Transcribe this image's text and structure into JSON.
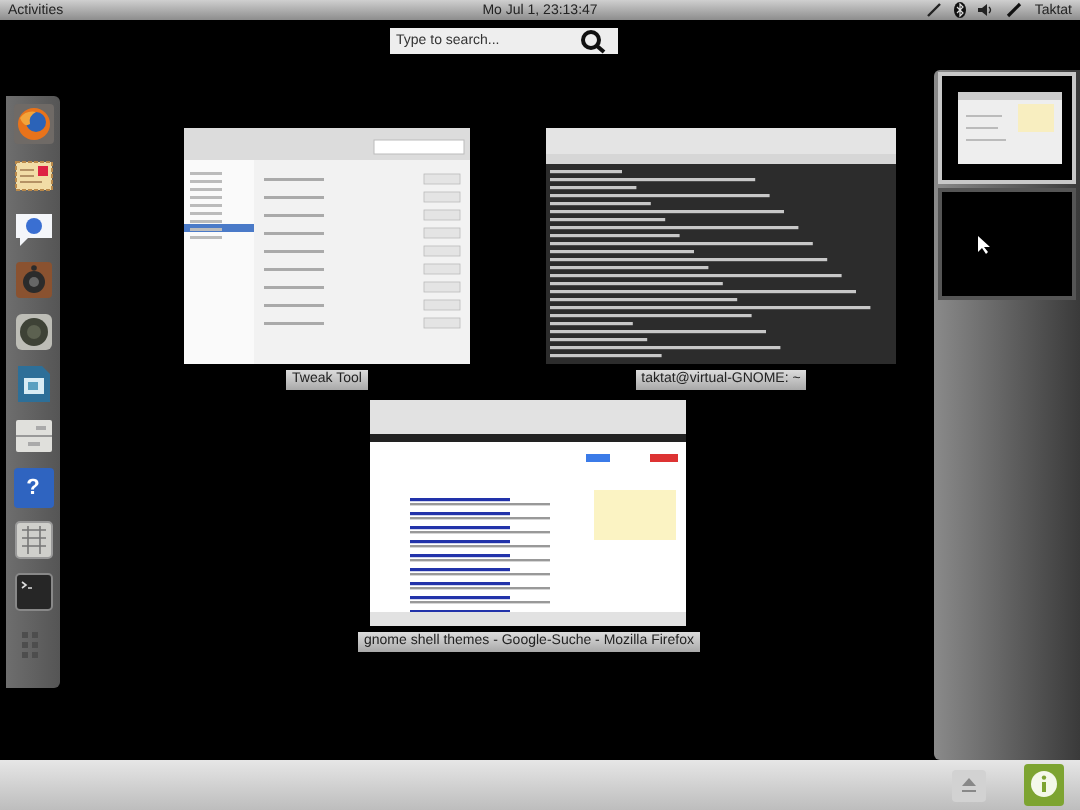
{
  "top_bar": {
    "activities": "Activities",
    "clock": "Mo Jul 1, 23:13:47",
    "user": "Taktat"
  },
  "search": {
    "placeholder": "Type to search..."
  },
  "dash": {
    "items": [
      {
        "kind": "browser"
      },
      {
        "kind": "mail"
      },
      {
        "kind": "chat"
      },
      {
        "kind": "speaker"
      },
      {
        "kind": "webcam"
      },
      {
        "kind": "document"
      },
      {
        "kind": "drawer"
      },
      {
        "kind": "help",
        "glyph": "?"
      },
      {
        "kind": "charmap"
      },
      {
        "kind": "terminal"
      },
      {
        "kind": "apps"
      }
    ]
  },
  "windows": [
    {
      "kind": "settings",
      "label": "Tweak Tool"
    },
    {
      "kind": "terminal",
      "label": "taktat@virtual-GNOME: ~"
    },
    {
      "kind": "browser",
      "label": "gnome shell themes - Google-Suche - Mozilla Firefox"
    }
  ],
  "workspaces": [
    {
      "selected": true,
      "kind": "windows"
    },
    {
      "selected": false,
      "kind": "empty"
    }
  ]
}
